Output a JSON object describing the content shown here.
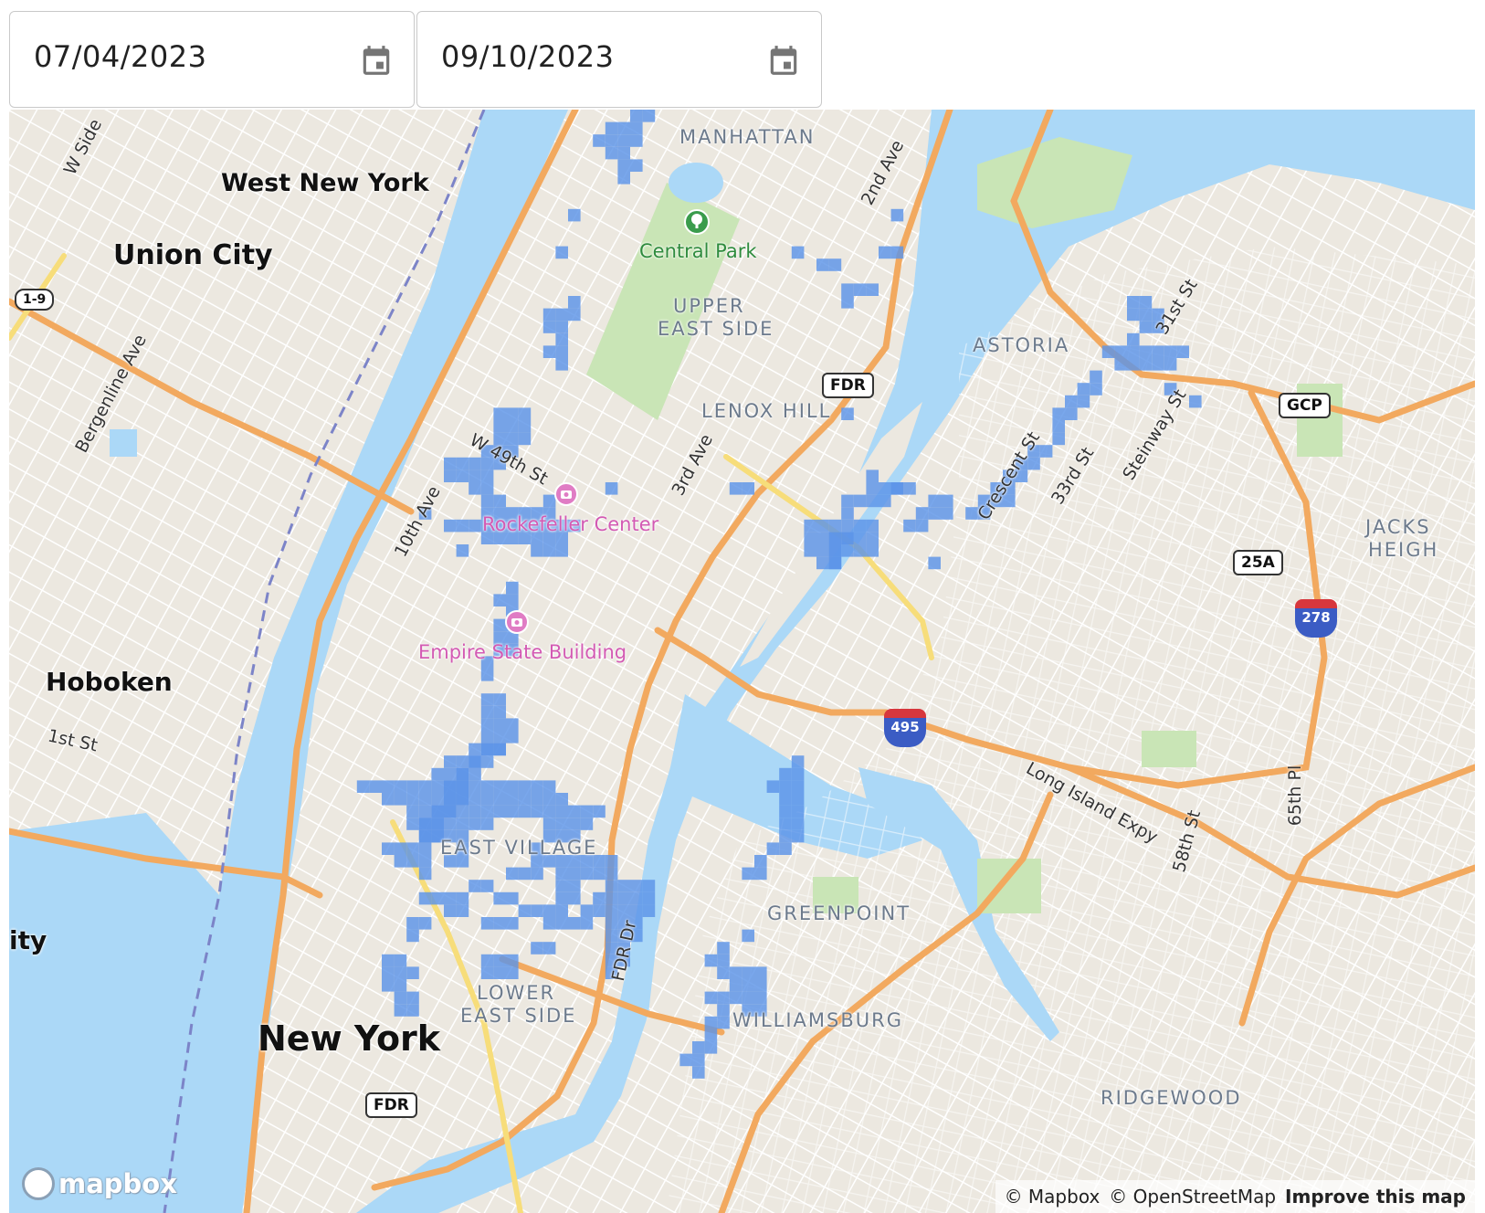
{
  "date_range": {
    "start": {
      "value": "07/04/2023",
      "icon": "calendar-icon"
    },
    "end": {
      "value": "09/10/2023",
      "icon": "calendar-icon"
    }
  },
  "map": {
    "colors": {
      "water": "#abd8f7",
      "land": "#ece8e0",
      "park": "#c9e5b6",
      "highway": "#f2a95f",
      "primary": "#f7dd7a",
      "heat_cell": "#5b94e8"
    },
    "labels": {
      "cities": [
        "West New York",
        "Union City",
        "Hoboken",
        "New York",
        "ity"
      ],
      "neighborhoods": [
        "MANHATTAN",
        "UPPER",
        "EAST SIDE",
        "LENOX HILL",
        "ASTORIA",
        "EAST VILLAGE",
        "LOWER",
        "EAST SIDE",
        "GREENPOINT",
        "WILLIAMSBURG",
        "RIDGEWOOD",
        "JACKS",
        "HEIGH"
      ],
      "streets": [
        "W Side",
        "Bergenline Ave",
        "1st St",
        "10th Ave",
        "W 49th St",
        "3rd Ave",
        "2nd Ave",
        "Crescent St",
        "33rd St",
        "31st St",
        "Steinway St",
        "Long Island Expy",
        "58th St",
        "65th Pl",
        "FDR Dr"
      ],
      "pois": [
        "Rockefeller Center",
        "Empire State Building"
      ],
      "parks": [
        "Central Park"
      ]
    },
    "shields": {
      "us19": "1-9",
      "fdr_top": "FDR",
      "gcp": "GCP",
      "r25a": "25A",
      "i278": "278",
      "i495": "495",
      "fdr_bottom": "FDR"
    },
    "attribution": {
      "mapbox": "© Mapbox",
      "osm": "© OpenStreetMap",
      "improve": "Improve this map"
    },
    "logo": "mapbox"
  }
}
